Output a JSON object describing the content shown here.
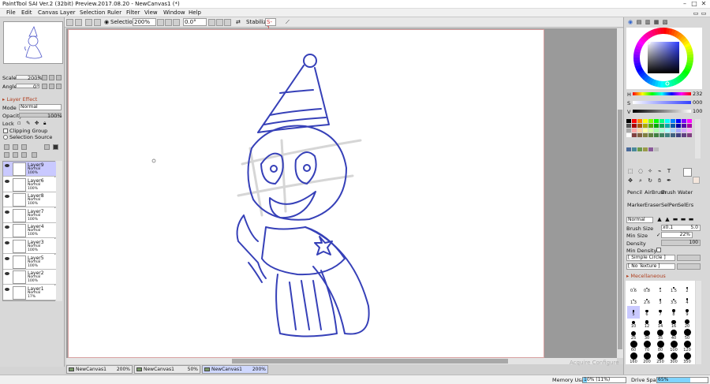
{
  "window": {
    "title": "PaintTool SAI Ver.2 (32bit) Preview.2017.08.20 - NewCanvas1 (*)",
    "minimize": "–",
    "maximize": "□",
    "close": "✕"
  },
  "menu": [
    "File",
    "Edit",
    "Canvas",
    "Layer",
    "Selection",
    "Ruler",
    "Filter",
    "View",
    "Window",
    "Help"
  ],
  "toolbar": {
    "selection_label": "Selection",
    "zoom": "200%",
    "angle": "0.0°",
    "stabilizer_label": "Stabilizer",
    "stabilizer_value": "S-1"
  },
  "navigator": {
    "scale_label": "Scale",
    "scale_value": "200%",
    "angle_label": "Angle",
    "angle_value": "0°"
  },
  "layer_panel": {
    "effect_label": "Layer Effect",
    "mode_label": "Mode",
    "mode_value": "Normal",
    "opacity_label": "Opacity",
    "opacity_value": "100%",
    "lock_label": "Lock",
    "clipping_label": "Clipping Group",
    "selection_source_label": "Selection Source",
    "layers": [
      {
        "name": "Layer9",
        "mode": "Normal",
        "opacity": "100%",
        "active": true
      },
      {
        "name": "Layer6",
        "mode": "Normal",
        "opacity": "100%",
        "active": false
      },
      {
        "name": "Layer8",
        "mode": "Normal",
        "opacity": "100%",
        "active": false
      },
      {
        "name": "Layer7",
        "mode": "Normal",
        "opacity": "100%",
        "active": false
      },
      {
        "name": "Layer4",
        "mode": "Normal",
        "opacity": "100%",
        "active": false
      },
      {
        "name": "Layer3",
        "mode": "Normal",
        "opacity": "100%",
        "active": false
      },
      {
        "name": "Layer5",
        "mode": "Normal",
        "opacity": "100%",
        "active": false
      },
      {
        "name": "Layer2",
        "mode": "Normal",
        "opacity": "100%",
        "active": false
      },
      {
        "name": "Layer1",
        "mode": "Normal",
        "opacity": "17%",
        "active": false
      }
    ]
  },
  "color_panel": {
    "h_label": "H",
    "h_value": "232",
    "s_label": "S",
    "s_value": "000",
    "v_label": "V",
    "v_value": "100",
    "current_color": "#3b3fb0"
  },
  "tools": {
    "brushes": [
      "Pencil",
      "AirBrush",
      "Brush",
      "Water"
    ],
    "brushes2": [
      "Marker",
      "Eraser",
      "SelPen",
      "SelErs"
    ]
  },
  "brush_settings": {
    "mode_value": "Normal",
    "size_label": "Brush Size",
    "size_mult": "x0.1",
    "size_value": "5.0",
    "min_size_label": "Min Size",
    "min_size_value": "22%",
    "density_label": "Density",
    "density_value": "100",
    "min_density_label": "Min Density",
    "shape_value": "[ Simple Circle ]",
    "texture_value": "[ No Texture ]",
    "misc_label": "Mecellaneous",
    "sizes": [
      "0.6",
      "0.8",
      "1",
      "1.5",
      "2",
      "1.3",
      "2.6",
      "3",
      "3.5",
      "4",
      "5",
      "6",
      "7",
      "8",
      "9",
      "10",
      "12",
      "14",
      "16",
      "20",
      "25",
      "30",
      "35",
      "40",
      "50",
      "60",
      "70",
      "80",
      "100",
      "120",
      "160",
      "200",
      "250",
      "300",
      "350"
    ]
  },
  "tabs": [
    {
      "name": "NewCanvas1",
      "zoom": "200%"
    },
    {
      "name": "NewCanvas1",
      "zoom": "50%"
    },
    {
      "name": "NewCanvas1",
      "zoom": "200%"
    }
  ],
  "status": {
    "memory_label": "Memory Usage",
    "memory_value": "10% (11%)",
    "memory_fraction": 0.1,
    "drive_label": "Drive Space",
    "drive_value": "65%",
    "drive_fraction": 0.65,
    "watermark": "Acquire Configure"
  }
}
